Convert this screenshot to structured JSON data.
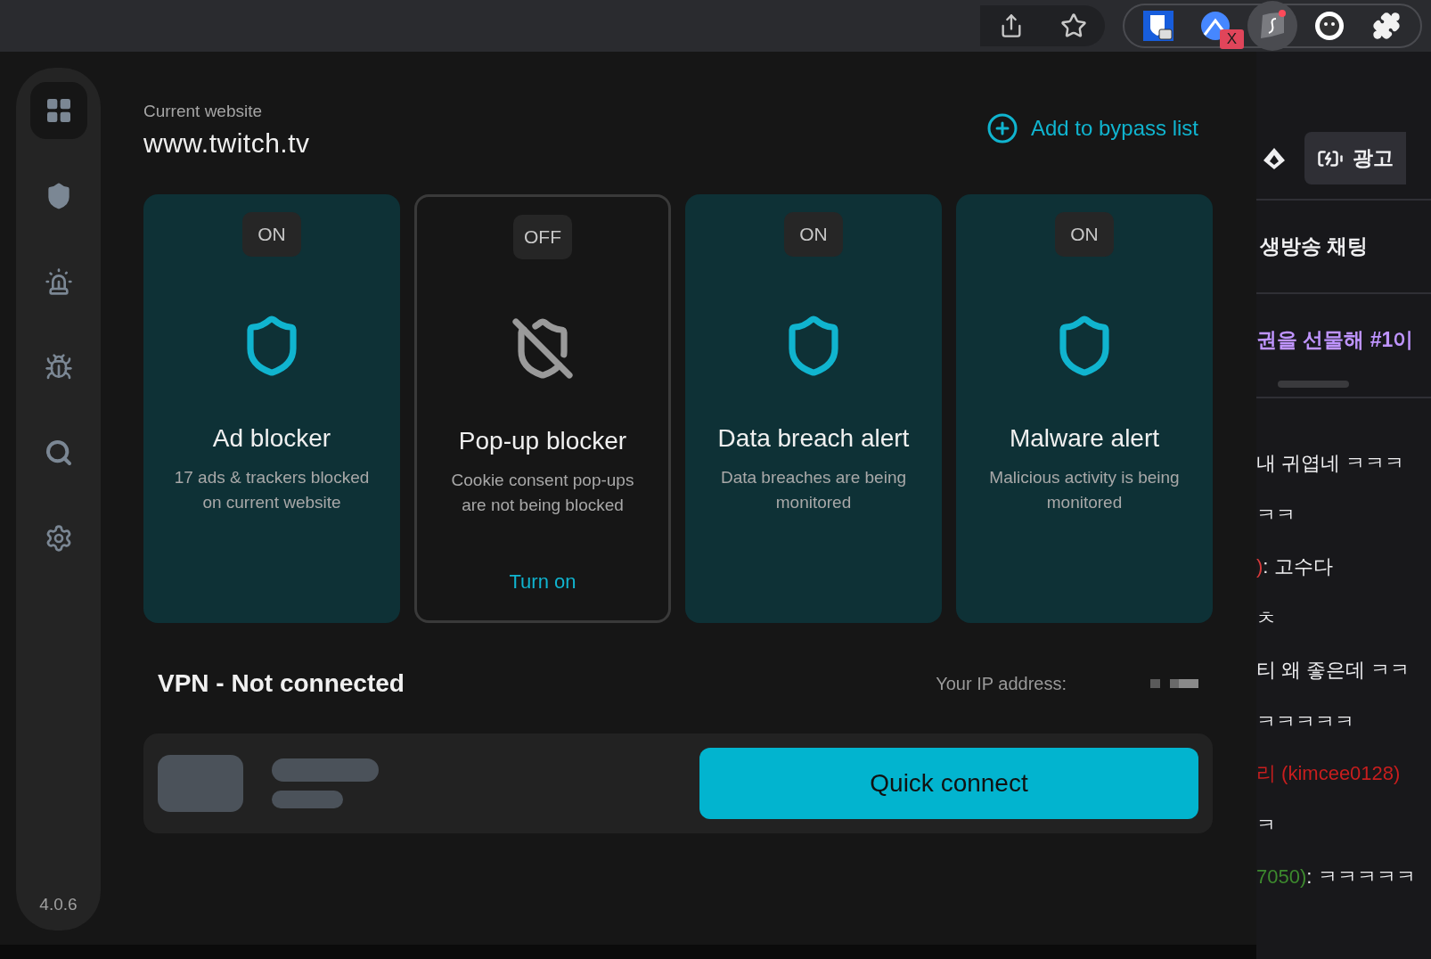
{
  "browser_toolbar": {
    "extensions": [
      {
        "kind": "vault",
        "selected": false
      },
      {
        "kind": "mountain",
        "selected": false,
        "badge": "X"
      },
      {
        "kind": "leaf",
        "selected": true
      },
      {
        "kind": "ghost",
        "selected": false
      },
      {
        "kind": "puzzle",
        "selected": false
      }
    ]
  },
  "sidebar": {
    "items": [
      {
        "kind": "dashboard",
        "selected": true
      },
      {
        "kind": "shield",
        "selected": false
      },
      {
        "kind": "siren",
        "selected": false
      },
      {
        "kind": "bug",
        "selected": false
      },
      {
        "kind": "search",
        "selected": false
      },
      {
        "kind": "settings",
        "selected": false
      }
    ],
    "version": "4.0.6"
  },
  "header": {
    "label": "Current website",
    "site": "www.twitch.tv",
    "bypass_link": "Add to bypass list"
  },
  "features": [
    {
      "status": "ON",
      "on": true,
      "title": "Ad blocker",
      "description": "17 ads & trackers blocked on current website"
    },
    {
      "status": "OFF",
      "on": false,
      "title": "Pop-up blocker",
      "description": "Cookie consent pop-ups are not being blocked",
      "action": "Turn on"
    },
    {
      "status": "ON",
      "on": true,
      "title": "Data breach alert",
      "description": "Data breaches are being monitored"
    },
    {
      "status": "ON",
      "on": true,
      "title": "Malware alert",
      "description": "Malicious activity is being monitored"
    }
  ],
  "vpn": {
    "title": "VPN - Not connected",
    "ip_label": "Your IP address:",
    "button": "Quick connect"
  },
  "chat": {
    "ad_button": "광고",
    "title": "생방송 채팅",
    "banner": "권을 선물해 #1이",
    "messages": [
      {
        "text": "내 귀엽네 ㅋㅋㅋ"
      },
      {
        "text": "ㅋㅋ"
      },
      {
        "name": ")",
        "color": "#d83a3a",
        "text": ": 고수다"
      },
      {
        "text": "ㅊ"
      },
      {
        "text": "티 왜 좋은데 ㅋㅋ"
      },
      {
        "text": "ㅋㅋㅋㅋㅋ"
      },
      {
        "name": "리 (kimcee0128)",
        "color": "#c81e1e"
      },
      {
        "text": "ㅋ"
      },
      {
        "name": "7050)",
        "color": "#3d8a2e",
        "text": ": ㅋㅋㅋㅋㅋ"
      }
    ]
  }
}
